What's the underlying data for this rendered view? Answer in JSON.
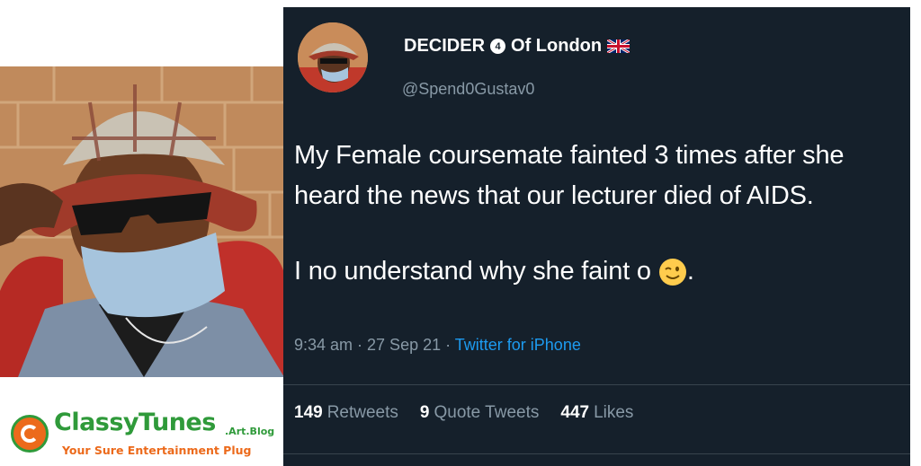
{
  "photo": {
    "description_icon": "person-bucket-hat-photo"
  },
  "watermark": {
    "name": "ClassyTunes",
    "suffix": ".Art.Blog",
    "tagline": "Your Sure Entertainment Plug"
  },
  "tweet": {
    "display_name": "DECIDER",
    "verified_glyph": "4",
    "display_name_suffix": "Of London",
    "handle": "@Spend0Gustav0",
    "text_line1": "My Female coursemate fainted 3  times after she heard the news that our lecturer died of AIDS.",
    "text_line2": "I no understand why she faint o",
    "text_line2_end": ".",
    "emoji": "winking-face-emoji",
    "time": "9:34 am · 27 Sep 21 · ",
    "source": "Twitter for iPhone",
    "stats": [
      {
        "count": "149",
        "label": "Retweets"
      },
      {
        "count": "9",
        "label": "Quote Tweets"
      },
      {
        "count": "447",
        "label": "Likes"
      }
    ]
  },
  "colors": {
    "tweet_bg": "#15202b",
    "secondary_text": "#8899a6",
    "link": "#1d9bf0",
    "brand_green": "#2f9a3a",
    "brand_orange": "#ec6a1b"
  }
}
